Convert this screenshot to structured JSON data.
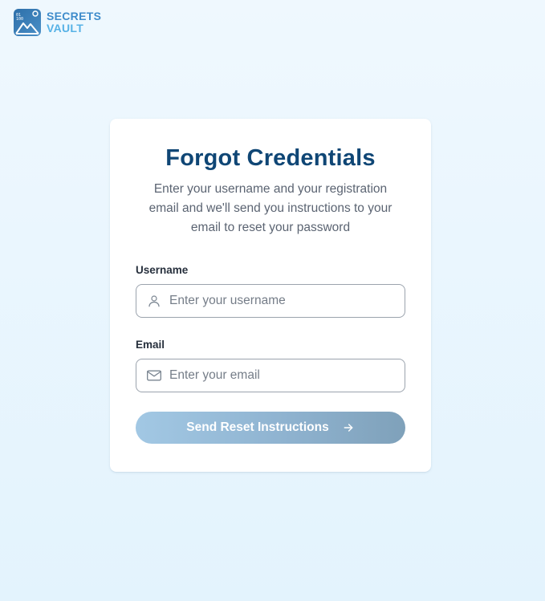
{
  "brand": {
    "line1": "SECRETS",
    "line2": "VAULT",
    "colors": {
      "primary": "#3f8ccb",
      "secondary": "#56b2e6"
    }
  },
  "card": {
    "title": "Forgot Credentials",
    "subtitle": "Enter your username and your registration email and we'll send you instructions to your email to reset your password"
  },
  "form": {
    "username": {
      "label": "Username",
      "placeholder": "Enter your username",
      "value": "",
      "icon": "user-icon"
    },
    "email": {
      "label": "Email",
      "placeholder": "Enter your email",
      "value": "",
      "icon": "mail-icon"
    },
    "submit": {
      "label": "Send Reset Instructions",
      "icon": "arrow-right-icon",
      "state": "disabled"
    }
  },
  "colors": {
    "title": "#0f4675",
    "background": "#eaf6fe",
    "button_start": "#a2c8e4",
    "button_end": "#7fa1ba"
  }
}
